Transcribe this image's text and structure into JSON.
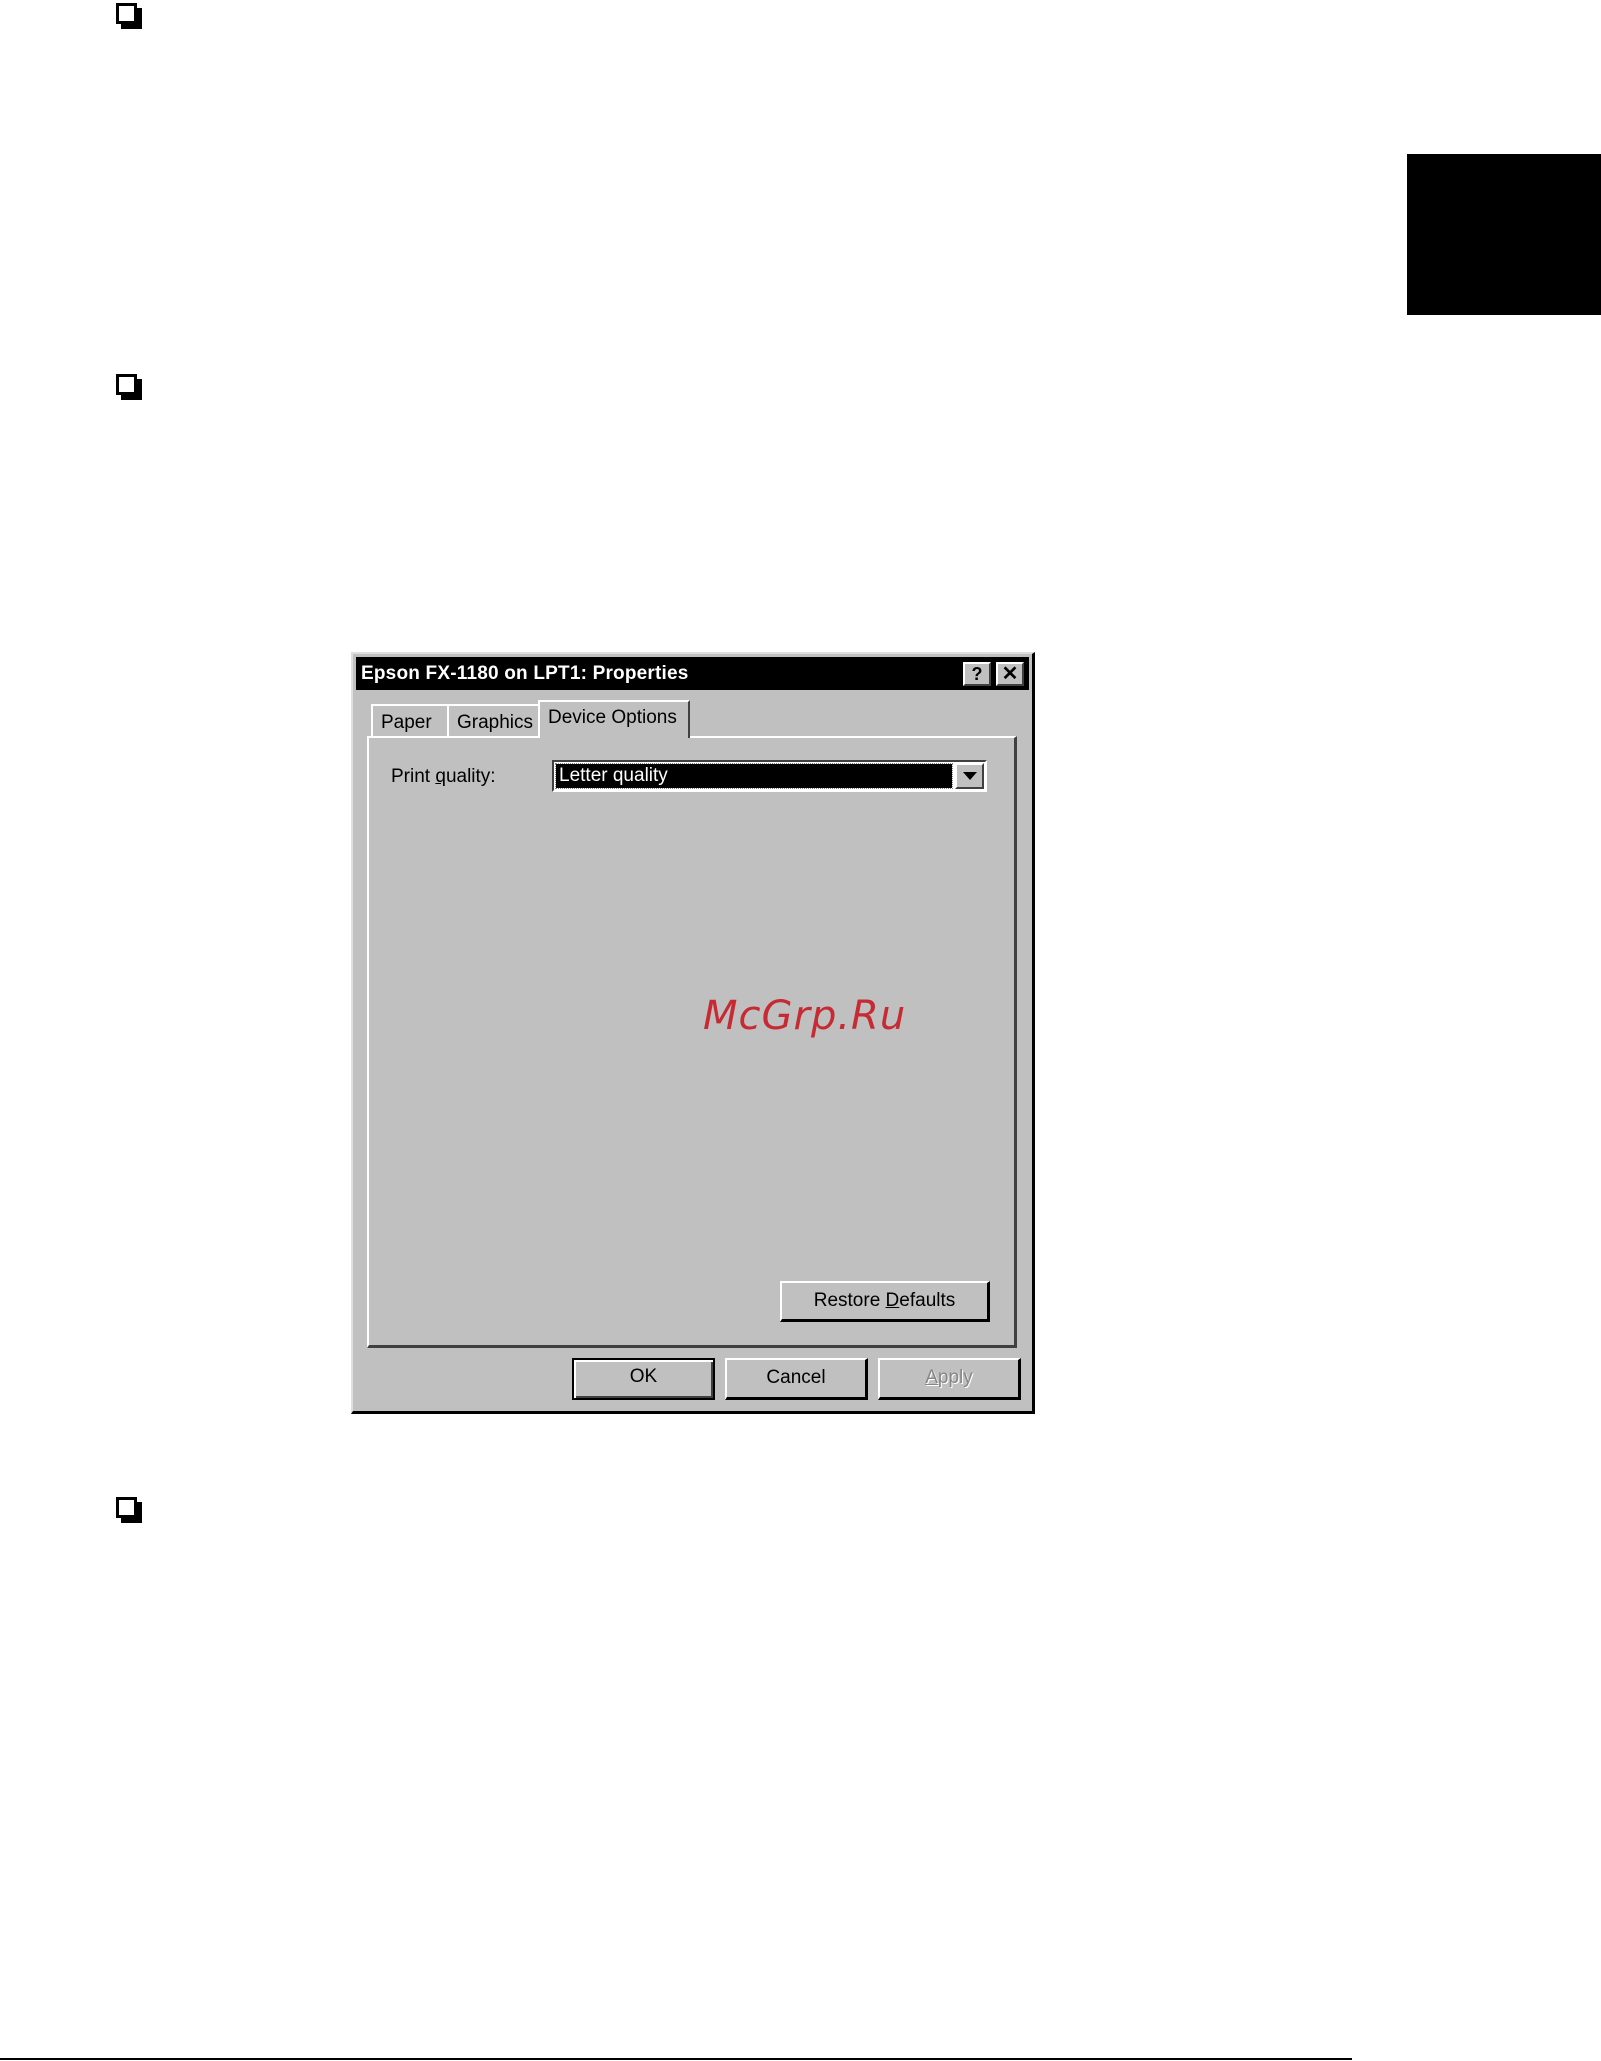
{
  "dialog": {
    "title": "Epson FX-1180 on LPT1: Properties",
    "help_glyph": "?",
    "close_glyph": "✕",
    "tabs": [
      {
        "label": "Paper",
        "active": false
      },
      {
        "label": "Graphics",
        "active": false
      },
      {
        "label": "Device Options",
        "active": true
      }
    ],
    "print_quality": {
      "label_before": "Print ",
      "label_accel": "q",
      "label_after": "uality:",
      "value": "Letter quality"
    },
    "buttons": {
      "restore_before": "Restore ",
      "restore_accel": "D",
      "restore_after": "efaults",
      "ok": "OK",
      "cancel": "Cancel",
      "apply_accel": "A",
      "apply_after": "pply"
    }
  },
  "watermark": "McGrp.Ru",
  "colors": {
    "dialog_face": "#c0c0c0",
    "titlebar": "#000000",
    "watermark": "#c62a32",
    "selection": "#000000"
  },
  "icons": [
    "bullet-checkbox-icon",
    "help-icon",
    "close-icon",
    "dropdown-arrow-icon"
  ]
}
